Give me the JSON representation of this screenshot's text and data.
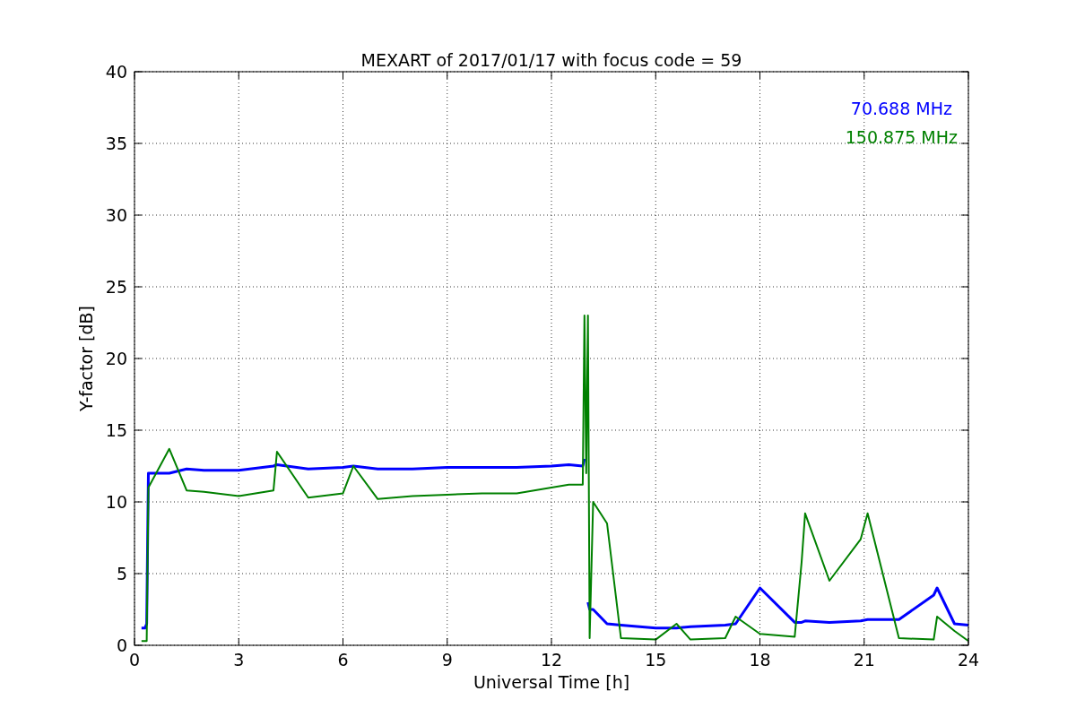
{
  "figure": {
    "chart_data": {
      "type": "line",
      "title": "MEXART of 2017/01/17 with focus code = 59",
      "xlabel": "Universal Time [h]",
      "ylabel": "Y-factor [dB]",
      "x": [
        0.2,
        0.3,
        0.35,
        0.4,
        1,
        1.5,
        2,
        3,
        4,
        4.1,
        5,
        6,
        6.3,
        7,
        8,
        9,
        10,
        11,
        12,
        12.5,
        12.9,
        12.95,
        13,
        13.05,
        13.1,
        13.2,
        13.6,
        14,
        15,
        15.6,
        16,
        17,
        17.3,
        18,
        19,
        19.2,
        19.3,
        20,
        20.9,
        21.1,
        22,
        23,
        23.1,
        23.6,
        24
      ],
      "series": [
        {
          "name": "70.688 MHz",
          "color": "#0000ff",
          "values": [
            1.2,
            1.2,
            1.5,
            12,
            12,
            12.3,
            12.2,
            12.2,
            12.5,
            12.6,
            12.3,
            12.4,
            12.5,
            12.3,
            12.3,
            12.4,
            12.4,
            12.4,
            12.5,
            12.6,
            12.5,
            13,
            null,
            3,
            2.5,
            2.5,
            1.5,
            1.4,
            1.2,
            1.2,
            1.3,
            1.4,
            1.5,
            4,
            1.6,
            1.6,
            1.7,
            1.6,
            1.7,
            1.8,
            1.8,
            3.5,
            4,
            1.5,
            1.4
          ]
        },
        {
          "name": "150.875 MHz",
          "color": "#008000",
          "values": [
            0.3,
            0.3,
            0.3,
            11,
            13.7,
            10.8,
            10.7,
            10.4,
            10.8,
            13.5,
            10.3,
            10.6,
            12.5,
            10.2,
            10.4,
            10.5,
            10.6,
            10.6,
            11,
            11.2,
            11.2,
            23,
            12,
            23,
            0.5,
            10,
            8.5,
            0.5,
            0.4,
            1.5,
            0.4,
            0.5,
            2,
            0.8,
            0.6,
            5.8,
            9.2,
            4.5,
            7.4,
            9.2,
            0.5,
            0.4,
            2,
            1,
            0.3
          ]
        }
      ],
      "xlim": [
        0,
        24
      ],
      "ylim": [
        0,
        40
      ],
      "xticks": [
        0,
        3,
        6,
        9,
        12,
        15,
        18,
        21,
        24
      ],
      "yticks": [
        0,
        5,
        10,
        15,
        20,
        25,
        30,
        35,
        40
      ],
      "grid": true
    }
  }
}
